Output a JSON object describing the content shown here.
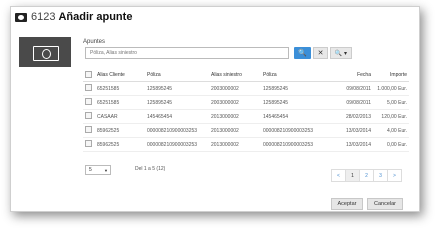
{
  "window": {
    "number": "6123",
    "title": "Añadir apunte"
  },
  "icons": {
    "title": "money-icon",
    "panel": "banknote-icon",
    "search": "search-icon",
    "clear": "close-icon",
    "options": "search-options-icon"
  },
  "search": {
    "section_label": "Apuntes",
    "placeholder": "Póliza, Alias siniestro",
    "search_symbol": "🔍",
    "clear_symbol": "✕",
    "options_symbol": "🔍 ▾"
  },
  "table": {
    "headers": [
      "Alias Cliente",
      "Póliza",
      "Alias siniestro",
      "Póliza",
      "Fecha",
      "Importe"
    ],
    "rows": [
      [
        "65251585",
        "125895245",
        "2003000002",
        "125895245",
        "09/08/2011",
        "1.000,00 Eur."
      ],
      [
        "65251585",
        "125895245",
        "2003000002",
        "125895245",
        "09/08/2011",
        "5,00 Eur."
      ],
      [
        "CASAAR",
        "145465454",
        "2013000002",
        "145465454",
        "28/02/2013",
        "120,00 Eur."
      ],
      [
        "85962525",
        "000008210900003253",
        "2013000002",
        "000008210900003253",
        "13/03/2014",
        "4,00 Eur."
      ],
      [
        "85962525",
        "000008210900003253",
        "2013000002",
        "000008210900003253",
        "13/03/2014",
        "0,00 Eur."
      ]
    ]
  },
  "pagination": {
    "page_size": "5",
    "info": "Del 1 a 5 (12)",
    "prev": "<",
    "pages": [
      "1",
      "2",
      "3"
    ],
    "next": ">",
    "current": "1"
  },
  "footer": {
    "accept": "Aceptar",
    "cancel": "Cancelar"
  }
}
